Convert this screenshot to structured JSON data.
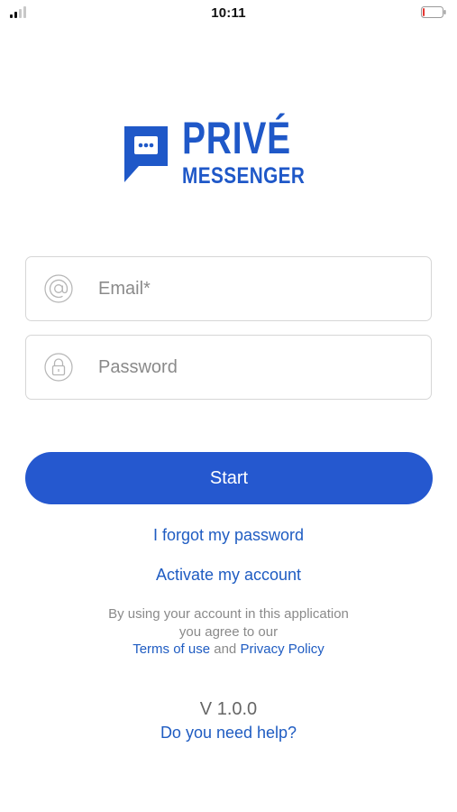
{
  "status_bar": {
    "time": "10:11",
    "signal_bars": 2,
    "battery_level": 0.1,
    "battery_color": "#e53935"
  },
  "logo": {
    "line1": "PRIVÉ",
    "line2": "MESSENGER",
    "color": "#1f58c8"
  },
  "login_form": {
    "email_placeholder": "Email*",
    "email_value": "",
    "email_icon": "at-icon",
    "password_placeholder": "Password",
    "password_value": "",
    "password_icon": "lock-icon"
  },
  "actions": {
    "start_label": "Start",
    "forgot_password": "I forgot my password",
    "activate_account": "Activate my account"
  },
  "terms": {
    "line1": "By using your account in this application",
    "line2": "you agree to our",
    "terms_link": "Terms of use",
    "and": "and",
    "privacy_link": "Privacy Policy"
  },
  "footer": {
    "version": "V 1.0.0",
    "help_link": "Do you need help?"
  },
  "colors": {
    "accent": "#2558cf",
    "link": "#1f5cc2",
    "muted_text": "#8a8a8a",
    "field_border": "#d6d6d6"
  }
}
